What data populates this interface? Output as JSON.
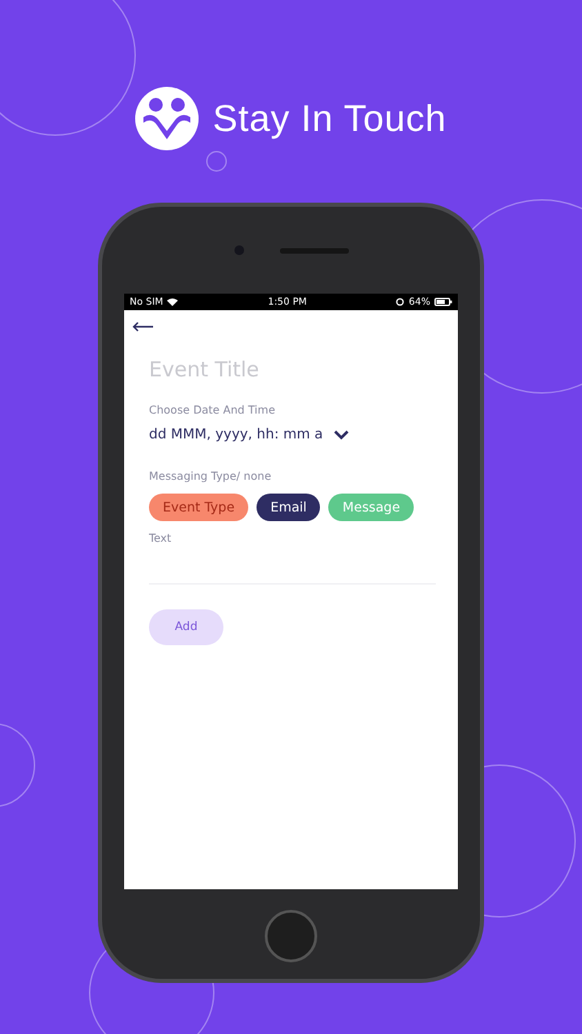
{
  "brand": {
    "title": "Stay In Touch"
  },
  "status_bar": {
    "carrier": "No SIM",
    "time": "1:50 PM",
    "battery": "64%"
  },
  "form": {
    "title_placeholder": "Event Title",
    "date_label": "Choose  Date And Time",
    "date_value": "dd MMM, yyyy, hh: mm a",
    "type_label": "Messaging Type/ none",
    "chips": [
      {
        "label": "Event Type",
        "kind": "placeholder",
        "color": "#f7876c"
      },
      {
        "label": "Email",
        "kind": "option",
        "color": "#2e2d63"
      },
      {
        "label": "Message",
        "kind": "option",
        "color": "#5ec98c"
      }
    ],
    "text_placeholder": "Text",
    "add_button": "Add"
  }
}
